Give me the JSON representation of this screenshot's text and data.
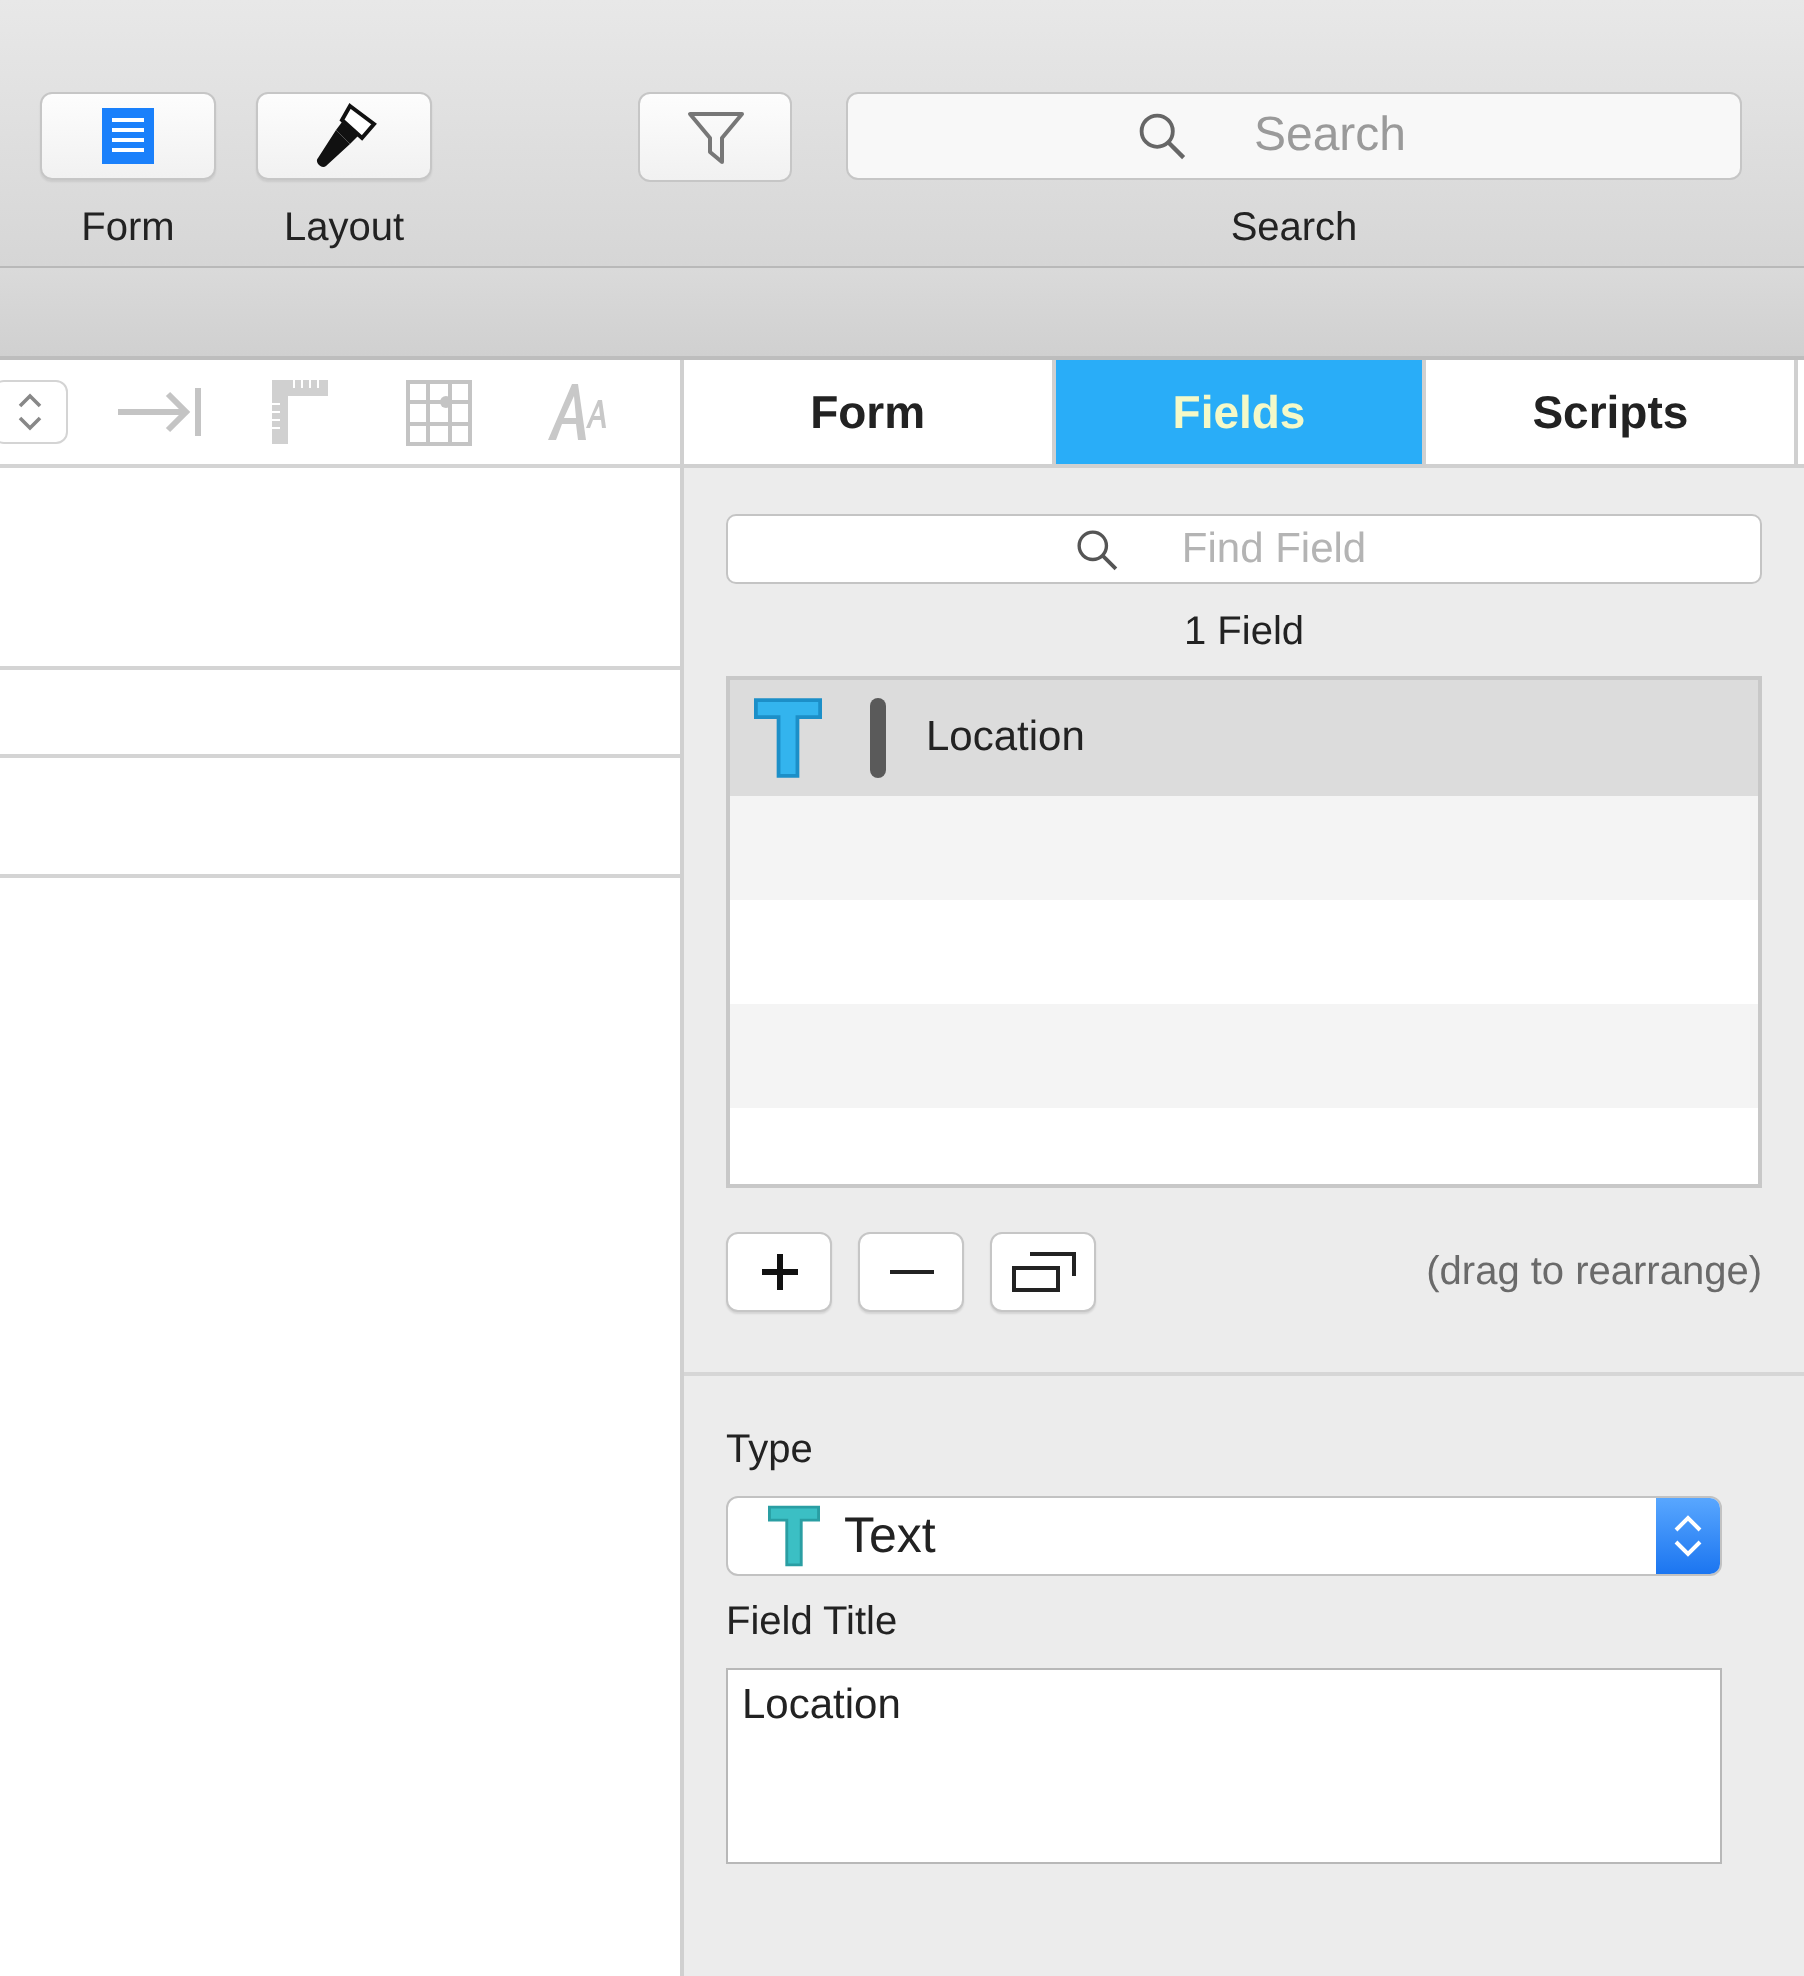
{
  "toolbar": {
    "buttons": [
      {
        "label": "Form",
        "kind": "form"
      },
      {
        "label": "Layout",
        "kind": "layout"
      }
    ],
    "search": {
      "placeholder": "Search",
      "label": "Search"
    }
  },
  "tabs": [
    {
      "label": "Form",
      "selected": false
    },
    {
      "label": "Fields",
      "selected": true
    },
    {
      "label": "Scripts",
      "selected": false
    }
  ],
  "fields_panel": {
    "find_placeholder": "Find Field",
    "count": "1 Field",
    "fields": [
      {
        "name": "Location",
        "selected": true
      }
    ],
    "hint": "(drag to rearrange)",
    "type_label": "Type",
    "type_value": "Text",
    "title_label": "Field Title",
    "title_value": "Location"
  }
}
